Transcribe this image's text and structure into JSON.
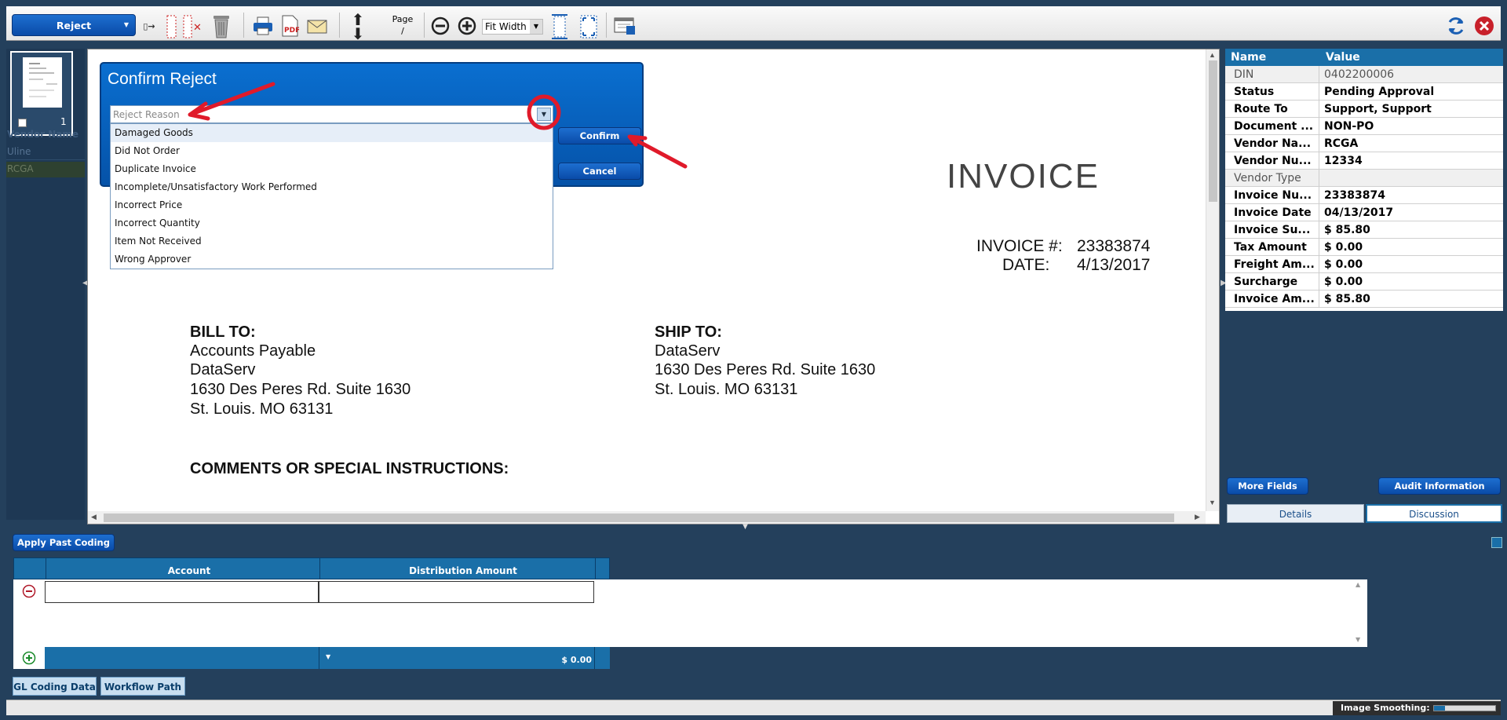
{
  "toolbar": {
    "action_label": "Reject",
    "page_label": "Page",
    "page_sep": "/",
    "zoom_value": "Fit Width"
  },
  "thumbnail": {
    "page_num": "1"
  },
  "left_panel": {
    "header": "Vendor Name",
    "rows": [
      "Uline",
      "RCGA"
    ]
  },
  "dialog": {
    "title": "Confirm Reject",
    "placeholder": "Reject Reason",
    "confirm_label": "Confirm",
    "cancel_label": "Cancel",
    "options": [
      "Damaged Goods",
      "Did Not Order",
      "Duplicate Invoice",
      "Incomplete/Unsatisfactory Work Performed",
      "Incorrect Price",
      "Incorrect Quantity",
      "Item Not Received",
      "Wrong Approver"
    ]
  },
  "document": {
    "title": "INVOICE",
    "invoice_no_label": "INVOICE #:",
    "invoice_no": "23383874",
    "date_label": "DATE:",
    "date": "4/13/2017",
    "bill_to_label": "BILL TO:",
    "bill_to": [
      "Accounts Payable",
      "DataServ",
      "1630 Des Peres Rd. Suite 1630",
      "St. Louis. MO 63131"
    ],
    "ship_to_label": "SHIP TO:",
    "ship_to": [
      "DataServ",
      "1630 Des Peres Rd. Suite 1630",
      "St. Louis. MO 63131"
    ],
    "comments_label": "COMMENTS OR SPECIAL INSTRUCTIONS:"
  },
  "fields": {
    "header_name": "Name",
    "header_value": "Value",
    "rows": [
      {
        "name": "DIN",
        "value": "0402200006",
        "muted": true
      },
      {
        "name": "Status",
        "value": "Pending Approval"
      },
      {
        "name": "Route To",
        "value": "Support, Support"
      },
      {
        "name": "Document ...",
        "value": "NON-PO"
      },
      {
        "name": "Vendor Na...",
        "value": "RCGA"
      },
      {
        "name": "Vendor Nu...",
        "value": "12334"
      },
      {
        "name": "Vendor Type",
        "value": "",
        "muted": true
      },
      {
        "name": "Invoice Nu...",
        "value": "23383874"
      },
      {
        "name": "Invoice Date",
        "value": "04/13/2017"
      },
      {
        "name": "Invoice Su...",
        "value": "$ 85.80"
      },
      {
        "name": "Tax Amount",
        "value": "$ 0.00"
      },
      {
        "name": "Freight Am...",
        "value": "$ 0.00"
      },
      {
        "name": "Surcharge",
        "value": "$ 0.00"
      },
      {
        "name": "Invoice Am...",
        "value": "$ 85.80"
      }
    ],
    "more_fields_label": "More Fields",
    "audit_label": "Audit Information",
    "tab_details": "Details",
    "tab_discussion": "Discussion"
  },
  "coding": {
    "apply_label": "Apply Past Coding",
    "col_account": "Account",
    "col_amount": "Distribution Amount",
    "total": "$ 0.00"
  },
  "bottom_tabs": [
    "GL Coding Data",
    "Workflow Path"
  ],
  "status": {
    "smoothing_label": "Image Smoothing:"
  },
  "colors": {
    "background": "#24405c",
    "accent": "#0a6fd0",
    "header_blue": "#1a6fa8",
    "annotation_red": "#e01a2a"
  }
}
